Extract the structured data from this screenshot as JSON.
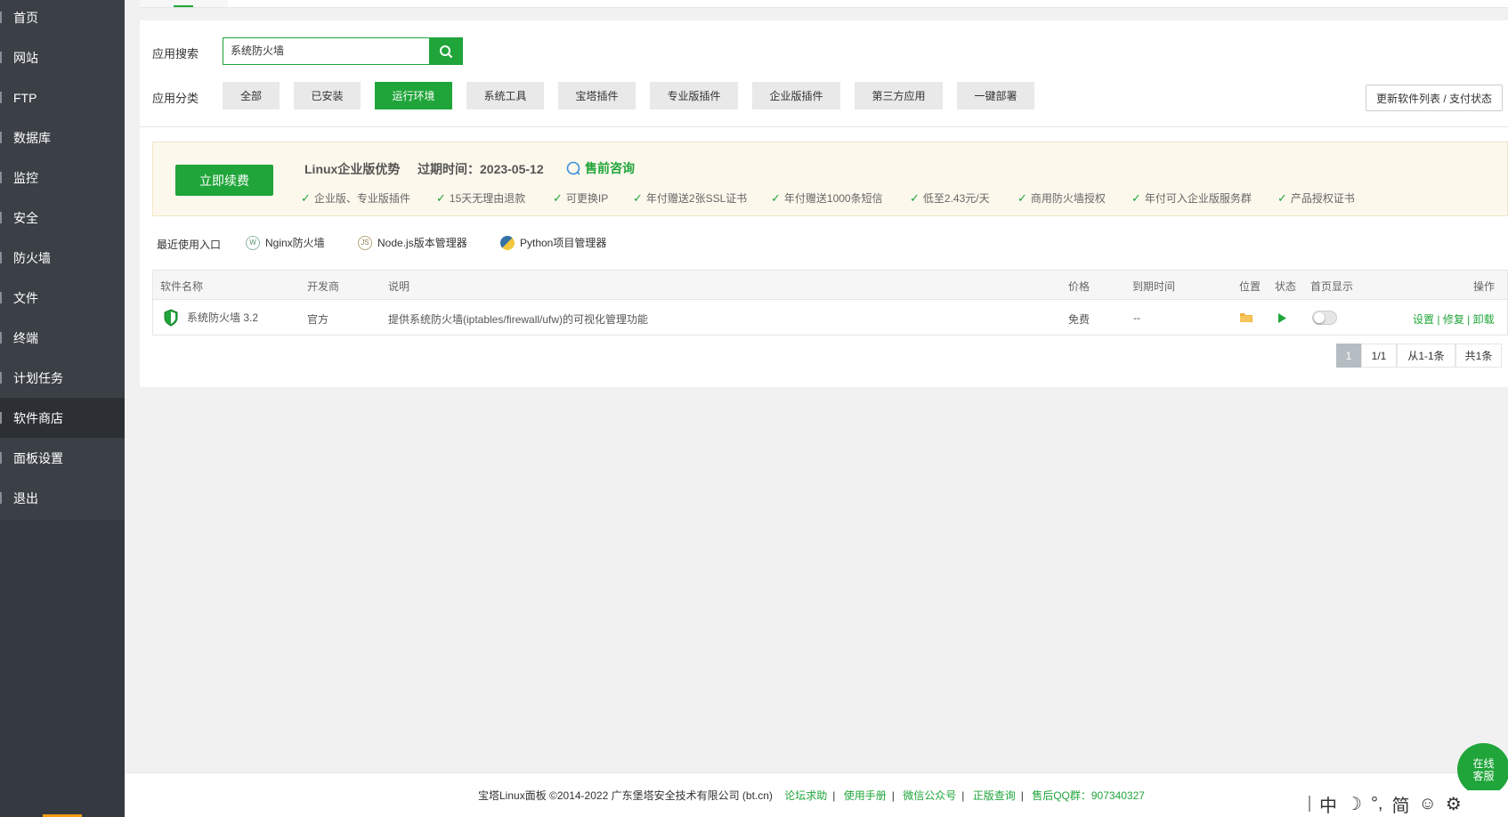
{
  "sidebar": {
    "items": [
      {
        "label": "首页"
      },
      {
        "label": "网站"
      },
      {
        "label": "FTP"
      },
      {
        "label": "数据库"
      },
      {
        "label": "监控"
      },
      {
        "label": "安全"
      },
      {
        "label": "防火墙"
      },
      {
        "label": "文件"
      },
      {
        "label": "终端"
      },
      {
        "label": "计划任务"
      },
      {
        "label": "软件商店",
        "active": true
      },
      {
        "label": "面板设置"
      },
      {
        "label": "退出"
      }
    ]
  },
  "search": {
    "label": "应用搜索",
    "value": "系统防火墙",
    "icon": "search-icon"
  },
  "categories": {
    "label": "应用分类",
    "items": [
      "全部",
      "已安装",
      "运行环境",
      "系统工具",
      "宝塔插件",
      "专业版插件",
      "企业版插件",
      "第三方应用",
      "一键部署"
    ],
    "active": "运行环境",
    "update_label": "更新软件列表 / 支付状态"
  },
  "promo": {
    "renew_label": "立即续费",
    "title": "Linux企业版优势",
    "expiry": "过期时间：2023-05-12",
    "presale_label": "售前咨询",
    "features": [
      "企业版、专业版插件",
      "15天无理由退款",
      "可更换IP",
      "年付赠送2张SSL证书",
      "年付赠送1000条短信",
      "低至2.43元/天",
      "商用防火墙授权",
      "年付可入企业版服务群",
      "产品授权证书"
    ]
  },
  "recent": {
    "label": "最近使用入口",
    "items": [
      {
        "label": "Nginx防火墙",
        "icon": "waf-icon"
      },
      {
        "label": "Node.js版本管理器",
        "icon": "nodejs-icon"
      },
      {
        "label": "Python项目管理器",
        "icon": "python-icon"
      }
    ]
  },
  "table": {
    "headers": {
      "name": "软件名称",
      "dev": "开发商",
      "desc": "说明",
      "price": "价格",
      "expire": "到期时间",
      "location": "位置",
      "status": "状态",
      "home": "首页显示",
      "ops": "操作"
    },
    "rows": [
      {
        "name": "系统防火墙 3.2",
        "dev": "官方",
        "desc": "提供系统防火墙(iptables/firewall/ufw)的可视化管理功能",
        "price": "免费",
        "expire": "--",
        "home_display": false,
        "ops": [
          "设置",
          "修复",
          "卸载"
        ]
      }
    ]
  },
  "pagination": {
    "current": "1",
    "pages": "1/1",
    "range": "从1-1条",
    "total": "共1条"
  },
  "footer": {
    "copyright": "宝塔Linux面板 ©2014-2022 广东堡塔安全技术有限公司 (bt.cn)",
    "links": [
      "论坛求助",
      "使用手册",
      "微信公众号",
      "正版查询"
    ],
    "qq": "售后QQ群：907340327"
  },
  "chat": {
    "line1": "在线",
    "line2": "客服"
  },
  "ime": {
    "items": [
      "中",
      "简"
    ]
  },
  "colors": {
    "brand": "#20a53a",
    "sidebar": "#3b4046",
    "promo_bg": "#fdf8ec"
  }
}
